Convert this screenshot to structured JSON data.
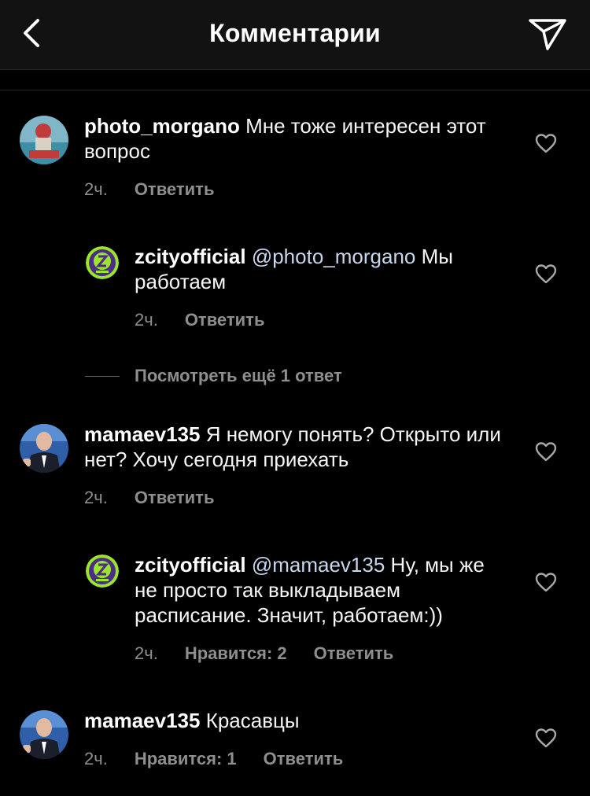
{
  "header": {
    "title": "Комментарии"
  },
  "comments": [
    {
      "user": "photo_morgano",
      "text": " Мне тоже интересен этот вопрос",
      "time": "2ч.",
      "reply": "Ответить"
    },
    {
      "user": "zcityofficial",
      "mention": "@photo_morgano",
      "text": " Мы работаем",
      "time": "2ч.",
      "reply": "Ответить"
    },
    {
      "user": "mamaev135",
      "text": " Я немогу понять? Открыто или нет? Хочу сегодня приехать",
      "time": "2ч.",
      "reply": "Ответить"
    },
    {
      "user": "zcityofficial",
      "mention": "@mamaev135",
      "text": " Ну, мы же не просто так выкладываем расписание. Значит, работаем:))",
      "time": "2ч.",
      "likes": "Нравится: 2",
      "reply": "Ответить"
    },
    {
      "user": "mamaev135",
      "text": " Красавцы",
      "time": "2ч.",
      "likes": "Нравится: 1",
      "reply": "Ответить"
    }
  ],
  "view_more": "Посмотреть ещё 1 ответ",
  "colors": {
    "background": "#000000",
    "header": "#121212",
    "meta": "#8e8e8e",
    "mention": "#c7d6ea",
    "zcity_green": "#9be62a"
  }
}
